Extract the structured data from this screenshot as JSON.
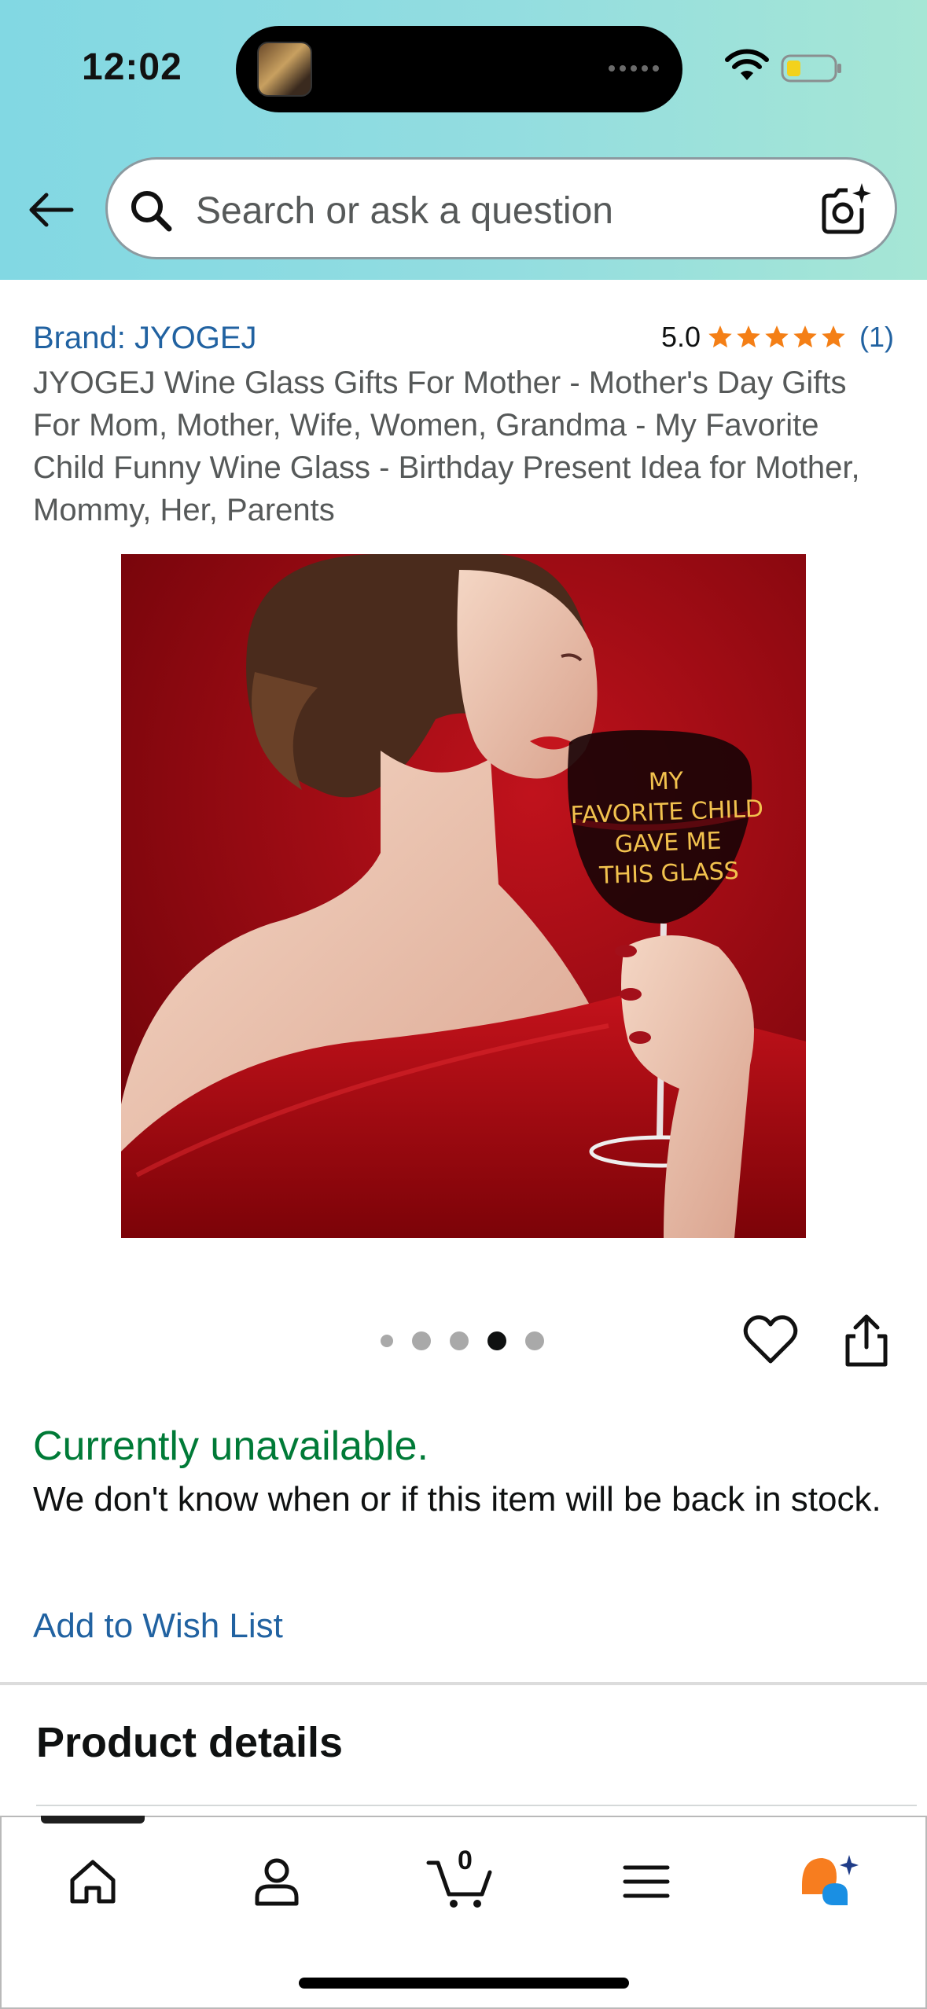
{
  "status_bar": {
    "time": "12:02"
  },
  "search": {
    "placeholder": "Search or ask a question"
  },
  "product": {
    "brand": "Brand: JYOGEJ",
    "rating_value": "5.0",
    "rating_stars": 5,
    "rating_count": "(1)",
    "title": "JYOGEJ Wine Glass Gifts For Mother - Mother's Day Gifts For Mom, Mother, Wife, Women, Grandma - My Favorite Child Funny Wine Glass - Birthday Present Idea for Mother, Mommy, Her, Parents",
    "image_text_lines": [
      "MY",
      "FAVORITE CHILD",
      "GAVE ME",
      "THIS GLASS"
    ],
    "carousel": {
      "count": 5,
      "active_index": 3
    }
  },
  "availability": {
    "status": "Currently unavailable.",
    "note": "We don't know when or if this item will be back in stock.",
    "wishlist_label": "Add to Wish List"
  },
  "sections": {
    "product_details": "Product details"
  },
  "bottom_nav": {
    "cart_count": "0",
    "items": [
      "home-icon",
      "account-icon",
      "cart-icon",
      "menu-icon",
      "rufus-icon"
    ]
  },
  "colors": {
    "link": "#2162a1",
    "available_status": "#007a37",
    "star": "#f47f16",
    "header_gradient_start": "#82d8e3",
    "header_gradient_end": "#a6e6d5"
  }
}
